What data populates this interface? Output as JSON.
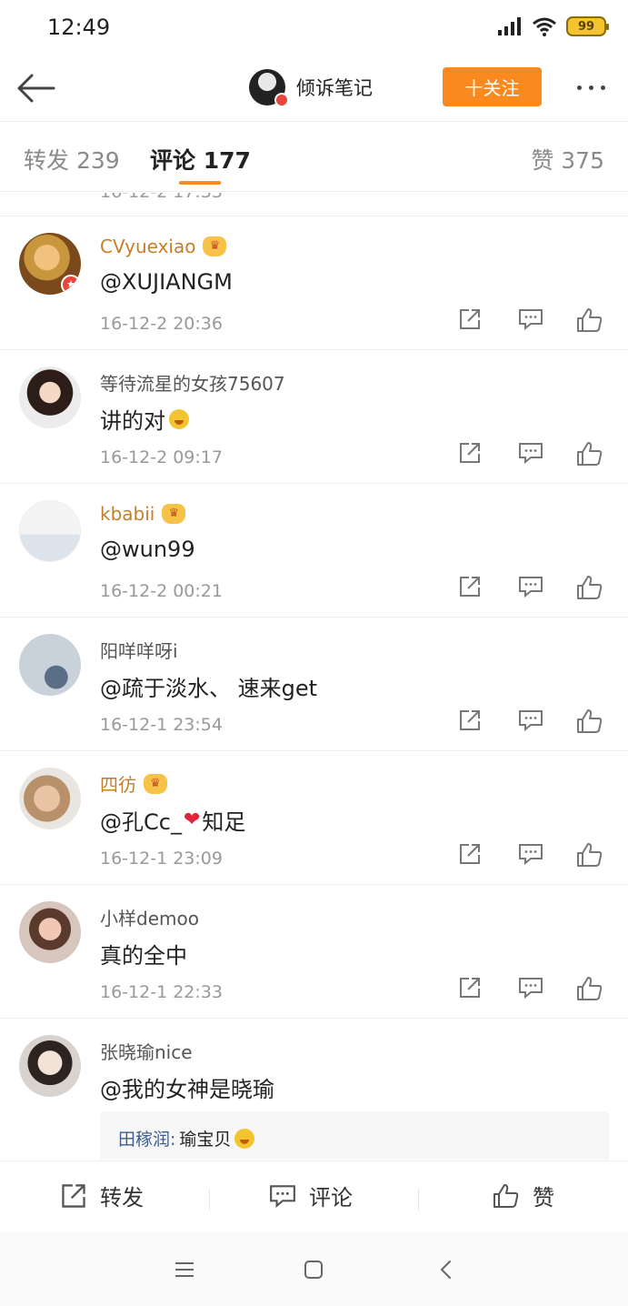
{
  "status_bar": {
    "time": "12:49",
    "battery": "99"
  },
  "nav": {
    "title": "倾诉笔记",
    "follow_label": "十关注"
  },
  "tabs": {
    "repost": "转发 239",
    "comment": "评论 177",
    "like": "赞 375"
  },
  "partial_time": "16-12-2 17:33",
  "comments": [
    {
      "username": "CVyuexiao",
      "vip": true,
      "content": "@XUJIANGM",
      "time": "16-12-2 20:36"
    },
    {
      "username": "等待流星的女孩75607",
      "vip": false,
      "content": "讲的对",
      "time": "16-12-2 09:17"
    },
    {
      "username": "kbabii",
      "vip": true,
      "content": "@wun99",
      "time": "16-12-2 00:21"
    },
    {
      "username": "阳咩咩呀i",
      "vip": false,
      "content": "@疏于淡水、 速来get",
      "time": "16-12-1 23:54"
    },
    {
      "username": "四彷",
      "vip": true,
      "content_before": "@孔Cc_",
      "content_after": "知足",
      "time": "16-12-1 23:09"
    },
    {
      "username": "小样demoo",
      "vip": false,
      "content": "真的全中",
      "time": "16-12-1 22:33"
    },
    {
      "username": "张晓瑜nice",
      "vip": false,
      "content": "@我的女神是晓瑜"
    }
  ],
  "reply": {
    "user": "田稼润:",
    "text": "瑜宝贝"
  },
  "bottom_bar": {
    "repost": "转发",
    "comment": "评论",
    "like": "赞"
  },
  "colors": {
    "accent": "#fa8a1f",
    "vip_name": "#c47f2a",
    "link_blue": "#3f5d8a"
  }
}
